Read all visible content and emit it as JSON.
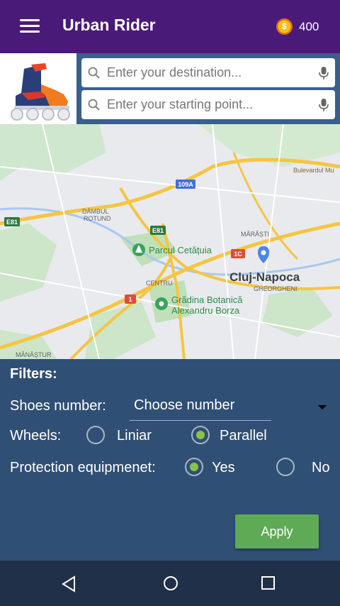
{
  "appbar": {
    "title": "Urban Rider",
    "coins": "400",
    "menu_icon": "hamburger-icon",
    "coin_icon": "coin-icon",
    "colors": {
      "bar": "#4a1a78",
      "coin": "#f4c20d"
    }
  },
  "search": {
    "destination_placeholder": "Enter your destination...",
    "start_placeholder": "Enter your starting point..."
  },
  "map": {
    "labels": {
      "city": "Cluj-Napoca",
      "district_gheorgheni": "GHEORGHENI",
      "park": "Parcul Cetățuia",
      "garden_line1": "Grădina Botanică",
      "garden_line2": "Alexandru Borza",
      "dambul_line1": "DÂMBUL",
      "dambul_line2": "ROTUND",
      "marasti": "MĂRĂȘTI",
      "centru": "CENTRU",
      "manastur": "MĂNĂȘTUR",
      "boulevard": "Bulevardul Mu",
      "road_e81_a": "E81",
      "road_e81_b": "E81",
      "road_109a": "109A",
      "road_1c": "1C",
      "road_1": "1"
    }
  },
  "filters": {
    "title": "Filters:",
    "shoes_label": "Shoes number:",
    "shoes_value": "Choose number",
    "wheels_label": "Wheels:",
    "wheels_options": [
      "Liniar",
      "Parallel"
    ],
    "wheels_selected": "Parallel",
    "protection_label": "Protection equipmenet:",
    "protection_options": [
      "Yes",
      "No"
    ],
    "protection_selected": "Yes",
    "apply_label": "Apply",
    "colors": {
      "panel": "#2f4f74",
      "radio_checked": "#8bc34a",
      "apply": "#5faa55"
    }
  },
  "navbar": {
    "back_icon": "back-triangle-icon",
    "home_icon": "home-circle-icon",
    "recents_icon": "recents-square-icon"
  }
}
